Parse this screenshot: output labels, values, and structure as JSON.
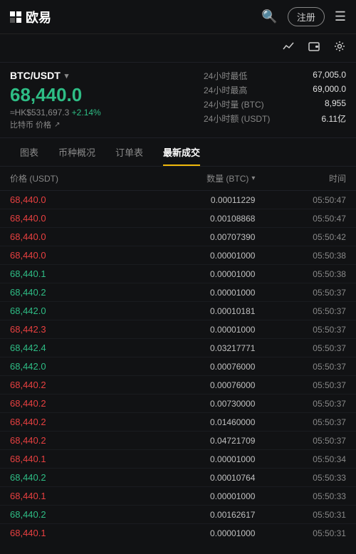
{
  "header": {
    "logo_text": "欧易",
    "register_label": "注册",
    "menu_icon": "☰",
    "search_icon": "🔍"
  },
  "sub_header": {
    "chart_icon": "📈",
    "wallet_icon": "🪙",
    "settings_icon": "⚙"
  },
  "ticker": {
    "pair": "BTC/USDT",
    "price": "68,440.0",
    "hk_price": "≈HK$531,697.3",
    "change": "+2.14%",
    "label": "比特币 价格",
    "stats": [
      {
        "label": "24小时最低",
        "value": "67,005.0"
      },
      {
        "label": "24小时最高",
        "value": "69,000.0"
      },
      {
        "label": "24小时量 (BTC)",
        "value": "8,955"
      },
      {
        "label": "24小时额 (USDT)",
        "value": "6.11亿"
      }
    ]
  },
  "tabs": [
    {
      "id": "chart",
      "label": "图表"
    },
    {
      "id": "market",
      "label": "币种概况"
    },
    {
      "id": "orders",
      "label": "订单表"
    },
    {
      "id": "trades",
      "label": "最新成交",
      "active": true
    }
  ],
  "table": {
    "headers": {
      "price": "价格 (USDT)",
      "qty": "数量 (BTC)",
      "time": "时间"
    },
    "rows": [
      {
        "price": "68,440.0",
        "color": "red",
        "qty": "0.00011229",
        "time": "05:50:47"
      },
      {
        "price": "68,440.0",
        "color": "red",
        "qty": "0.00108868",
        "time": "05:50:47"
      },
      {
        "price": "68,440.0",
        "color": "red",
        "qty": "0.00707390",
        "time": "05:50:42"
      },
      {
        "price": "68,440.0",
        "color": "red",
        "qty": "0.00001000",
        "time": "05:50:38"
      },
      {
        "price": "68,440.1",
        "color": "green",
        "qty": "0.00001000",
        "time": "05:50:38"
      },
      {
        "price": "68,440.2",
        "color": "green",
        "qty": "0.00001000",
        "time": "05:50:37"
      },
      {
        "price": "68,442.0",
        "color": "green",
        "qty": "0.00010181",
        "time": "05:50:37"
      },
      {
        "price": "68,442.3",
        "color": "red",
        "qty": "0.00001000",
        "time": "05:50:37"
      },
      {
        "price": "68,442.4",
        "color": "green",
        "qty": "0.03217771",
        "time": "05:50:37"
      },
      {
        "price": "68,442.0",
        "color": "green",
        "qty": "0.00076000",
        "time": "05:50:37"
      },
      {
        "price": "68,440.2",
        "color": "red",
        "qty": "0.00076000",
        "time": "05:50:37"
      },
      {
        "price": "68,440.2",
        "color": "red",
        "qty": "0.00730000",
        "time": "05:50:37"
      },
      {
        "price": "68,440.2",
        "color": "red",
        "qty": "0.01460000",
        "time": "05:50:37"
      },
      {
        "price": "68,440.2",
        "color": "red",
        "qty": "0.04721709",
        "time": "05:50:37"
      },
      {
        "price": "68,440.1",
        "color": "red",
        "qty": "0.00001000",
        "time": "05:50:34"
      },
      {
        "price": "68,440.2",
        "color": "green",
        "qty": "0.00010764",
        "time": "05:50:33"
      },
      {
        "price": "68,440.1",
        "color": "red",
        "qty": "0.00001000",
        "time": "05:50:33"
      },
      {
        "price": "68,440.2",
        "color": "green",
        "qty": "0.00162617",
        "time": "05:50:31"
      },
      {
        "price": "68,440.1",
        "color": "red",
        "qty": "0.00001000",
        "time": "05:50:31"
      }
    ]
  }
}
